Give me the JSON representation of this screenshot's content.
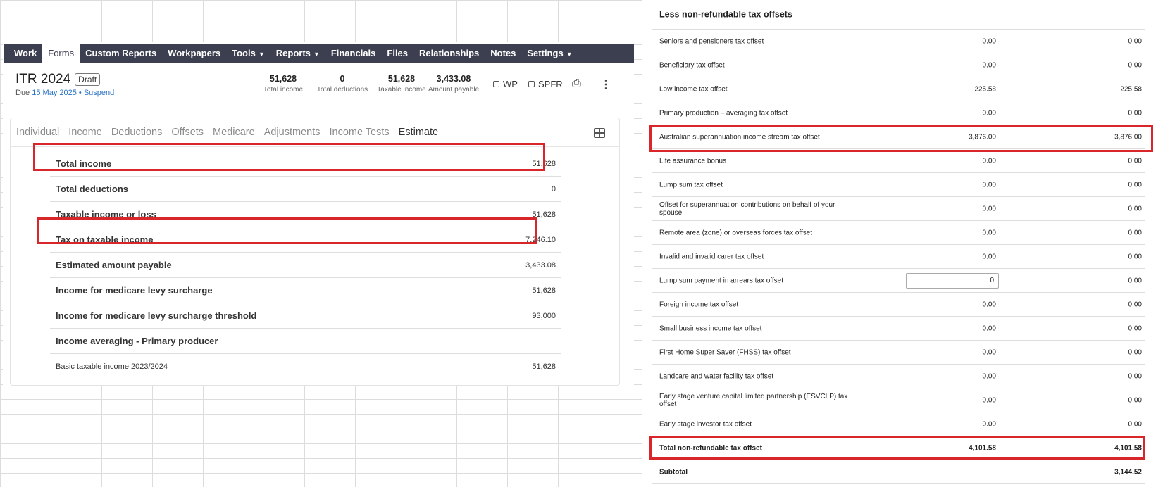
{
  "nav": {
    "items": [
      {
        "label": "Work",
        "active": false
      },
      {
        "label": "Forms",
        "active": true
      },
      {
        "label": "Custom Reports",
        "active": false
      },
      {
        "label": "Workpapers",
        "active": false
      },
      {
        "label": "Tools",
        "active": false,
        "dropdown": true
      },
      {
        "label": "Reports",
        "active": false,
        "dropdown": true
      },
      {
        "label": "Financials",
        "active": false
      },
      {
        "label": "Files",
        "active": false
      },
      {
        "label": "Relationships",
        "active": false
      },
      {
        "label": "Notes",
        "active": false
      },
      {
        "label": "Settings",
        "active": false,
        "dropdown": true
      }
    ]
  },
  "header": {
    "title": "ITR 2024",
    "badge": "Draft",
    "due_prefix": "Due",
    "due_date": "15 May 2025",
    "separator": "•",
    "suspend": "Suspend"
  },
  "summary": [
    {
      "value": "51,628",
      "label": "Total income"
    },
    {
      "value": "0",
      "label": "Total deductions"
    },
    {
      "value": "51,628",
      "label": "Taxable income"
    },
    {
      "value": "3,433.08",
      "label": "Amount payable"
    }
  ],
  "checks": {
    "wp": "WP",
    "spfr": "SPFR"
  },
  "icons": {
    "print": "printer-icon",
    "more": "more-vertical-icon",
    "layout": "grid-layout-icon"
  },
  "tabs": [
    "Individual",
    "Income",
    "Deductions",
    "Offsets",
    "Medicare",
    "Adjustments",
    "Income Tests",
    "Estimate"
  ],
  "active_tab": "Estimate",
  "estimate_rows": [
    {
      "label": "Total income",
      "value": "51,628"
    },
    {
      "label": "Total deductions",
      "value": "0"
    },
    {
      "label": "Taxable income or loss",
      "value": "51,628"
    },
    {
      "label": "Tax on taxable income",
      "value": "7,246.10"
    },
    {
      "label": "Estimated amount payable",
      "value": "3,433.08"
    },
    {
      "label": "Income for medicare levy surcharge",
      "value": "51,628"
    },
    {
      "label": "Income for medicare levy surcharge threshold",
      "value": "93,000"
    },
    {
      "label": "Income averaging - Primary producer",
      "value": ""
    },
    {
      "label": "Basic taxable income 2023/2024",
      "value": "51,628"
    }
  ],
  "offsets": {
    "header": "Less non-refundable tax offsets",
    "rows": [
      {
        "label": "Seniors and pensioners tax offset",
        "v1": "0.00",
        "v2": "0.00"
      },
      {
        "label": "Beneficiary tax offset",
        "v1": "0.00",
        "v2": "0.00"
      },
      {
        "label": "Low income tax offset",
        "v1": "225.58",
        "v2": "225.58"
      },
      {
        "label": "Primary production – averaging tax offset",
        "v1": "0.00",
        "v2": "0.00"
      },
      {
        "label": "Australian superannuation income stream tax offset",
        "v1": "3,876.00",
        "v2": "3,876.00"
      },
      {
        "label": "Life assurance bonus",
        "v1": "0.00",
        "v2": "0.00"
      },
      {
        "label": "Lump sum tax offset",
        "v1": "0.00",
        "v2": "0.00"
      },
      {
        "label": "Offset for superannuation contributions on behalf of your spouse",
        "v1": "0.00",
        "v2": "0.00"
      },
      {
        "label": "Remote area (zone) or overseas forces tax offset",
        "v1": "0.00",
        "v2": "0.00"
      },
      {
        "label": "Invalid and invalid carer tax offset",
        "v1": "0.00",
        "v2": "0.00"
      },
      {
        "label": "Lump sum payment in arrears tax offset",
        "v1": "0",
        "v2": "0.00",
        "input": true
      },
      {
        "label": "Foreign income tax offset",
        "v1": "0.00",
        "v2": "0.00"
      },
      {
        "label": "Small business income tax offset",
        "v1": "0.00",
        "v2": "0.00"
      },
      {
        "label": "First Home Super Saver (FHSS) tax offset",
        "v1": "0.00",
        "v2": "0.00"
      },
      {
        "label": "Landcare and water facility tax offset",
        "v1": "0.00",
        "v2": "0.00"
      },
      {
        "label": "Early stage venture capital limited partnership (ESVCLP) tax offset",
        "v1": "0.00",
        "v2": "0.00"
      },
      {
        "label": "Early stage investor tax offset",
        "v1": "0.00",
        "v2": "0.00"
      },
      {
        "label": "Total non-refundable tax offset",
        "v1": "4,101.58",
        "v2": "4,101.58",
        "bold": true
      },
      {
        "label": "Subtotal",
        "v1": "",
        "v2": "3,144.52",
        "bold": true
      }
    ]
  },
  "colors": {
    "nav_bg": "#3b3f4f",
    "accent": "#2a72c6",
    "highlight": "#d9262b"
  }
}
